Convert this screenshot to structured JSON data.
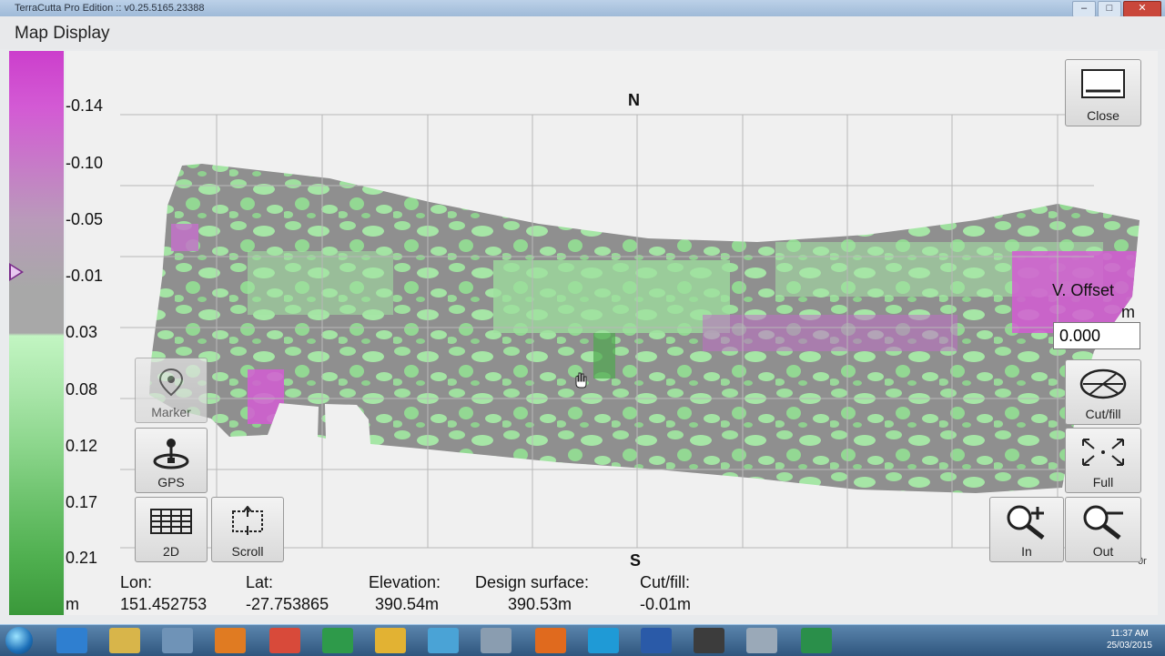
{
  "window": {
    "title": "TerraCutta Pro Edition :: v0.25.5165.23388"
  },
  "header": {
    "title": "Map Display"
  },
  "legend": {
    "labels": [
      "-0.14",
      "-0.10",
      "-0.05",
      "-0.01",
      "0.03",
      "0.08",
      "0.12",
      "0.17",
      "0.21",
      "m"
    ]
  },
  "map": {
    "north": "N",
    "south": "S",
    "partial_label": "0r"
  },
  "buttons": {
    "close": "Close",
    "marker": "Marker",
    "gps": "GPS",
    "view2d": "2D",
    "scroll": "Scroll",
    "cutfill": "Cut/fill",
    "full": "Full",
    "zoom_in": "In",
    "zoom_out": "Out"
  },
  "v_offset": {
    "label": "V. Offset",
    "unit": "m",
    "value": "0.000"
  },
  "status": {
    "lon_label": "Lon:",
    "lon_value": "151.452753",
    "lat_label": "Lat:",
    "lat_value": "-27.753865",
    "elevation_label": "Elevation:",
    "elevation_value": "390.54m",
    "design_label": "Design surface:",
    "design_value": "390.53m",
    "cutfill_label": "Cut/fill:",
    "cutfill_value": "-0.01m"
  },
  "taskbar": {
    "time": "11:37 AM",
    "date": "25/03/2015"
  },
  "colors": {
    "cut": "#cc3fcc",
    "neutral": "#8c8c8c",
    "fill": "#9ee39e"
  }
}
